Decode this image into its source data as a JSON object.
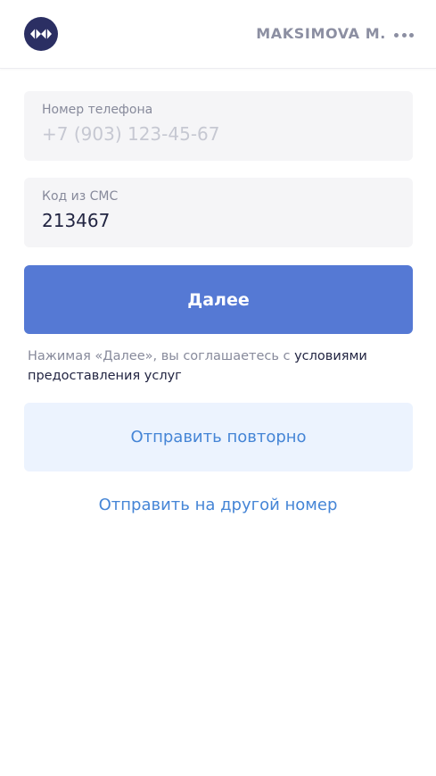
{
  "header": {
    "user_name": "MAKSIMOVA M.",
    "logo_icon": "brand-logo-icon",
    "menu_icon": "more-dots-icon"
  },
  "phone_field": {
    "label": "Номер телефона",
    "placeholder": "+7 (903) 123-45-67",
    "value": ""
  },
  "sms_field": {
    "label": "Код из СМС",
    "value": "213467"
  },
  "next_button": {
    "label": "Далее"
  },
  "terms": {
    "text": "Нажимая «Далее», вы соглашаетесь с ",
    "link": "условиями предоставления услуг"
  },
  "resend_button": {
    "label": "Отправить повторно"
  },
  "other_number_link": {
    "label": "Отправить на другой номер"
  },
  "colors": {
    "primary": "#5579d4",
    "link": "#4585d6",
    "logo_bg": "#2b2f63",
    "secondary_bg": "#ecf3fe",
    "field_bg": "#f5f5f7"
  }
}
